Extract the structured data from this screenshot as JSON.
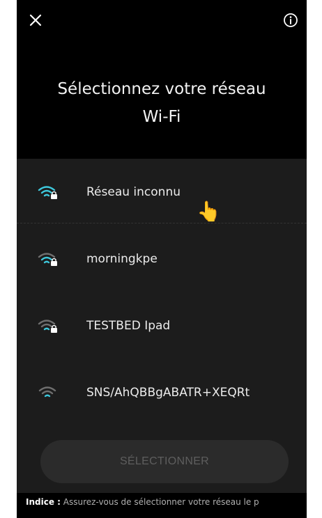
{
  "header": {
    "close_icon": "close-icon",
    "info_icon": "info-icon"
  },
  "title": {
    "line1": "Sélectionnez votre réseau",
    "line2": "Wi-Fi"
  },
  "networks": [
    {
      "ssid": "Réseau inconnu",
      "icon": "wifi-lock-icon",
      "signal_color": "#3ec8dc"
    },
    {
      "ssid": "morningkpe",
      "icon": "wifi-lock-icon",
      "signal_color": "#3ec8dc"
    },
    {
      "ssid": "TESTBED Ipad",
      "icon": "wifi-lock-icon",
      "signal_color": "#3ec8dc"
    },
    {
      "ssid": "SNS/AhQBBgABATR+XEQRt",
      "icon": "wifi-icon",
      "signal_color": "#3ec8dc"
    }
  ],
  "select_button": {
    "label": "SÉLECTIONNER"
  },
  "hint": {
    "label": "Indice :",
    "text": " Assurez-vous de sélectionner votre réseau le p"
  },
  "colors": {
    "background": "#000000",
    "panel": "#1c1c1c",
    "accent": "#3ec8dc",
    "button_bg": "#2b2b2b",
    "button_text": "#5e5e5e"
  }
}
